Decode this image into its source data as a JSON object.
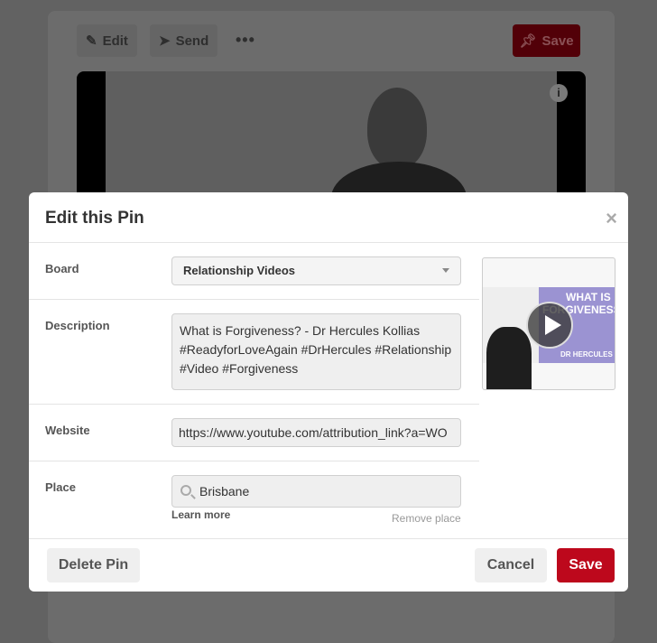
{
  "background": {
    "edit_label": "Edit",
    "send_label": "Send",
    "more_label": "•••",
    "save_label": "Save",
    "info_label": "i"
  },
  "modal": {
    "title": "Edit this Pin",
    "close": "×",
    "board": {
      "label": "Board",
      "value": "Relationship Videos"
    },
    "description": {
      "label": "Description",
      "value": "What is Forgiveness? - Dr Hercules Kollias #ReadyforLoveAgain #DrHercules #Relationship #Video #Forgiveness"
    },
    "website": {
      "label": "Website",
      "value": "https://www.youtube.com/attribution_link?a=WO"
    },
    "place": {
      "label": "Place",
      "value": "Brisbane",
      "learn_more": "Learn more",
      "remove": "Remove place"
    },
    "thumbnail": {
      "title_line1": "WHAT IS",
      "title_line2": "FORGIVENESS?",
      "subtitle": "DR HERCULES"
    },
    "delete_label": "Delete Pin",
    "cancel_label": "Cancel",
    "save_label": "Save"
  },
  "colors": {
    "accent": "#bd081c"
  }
}
